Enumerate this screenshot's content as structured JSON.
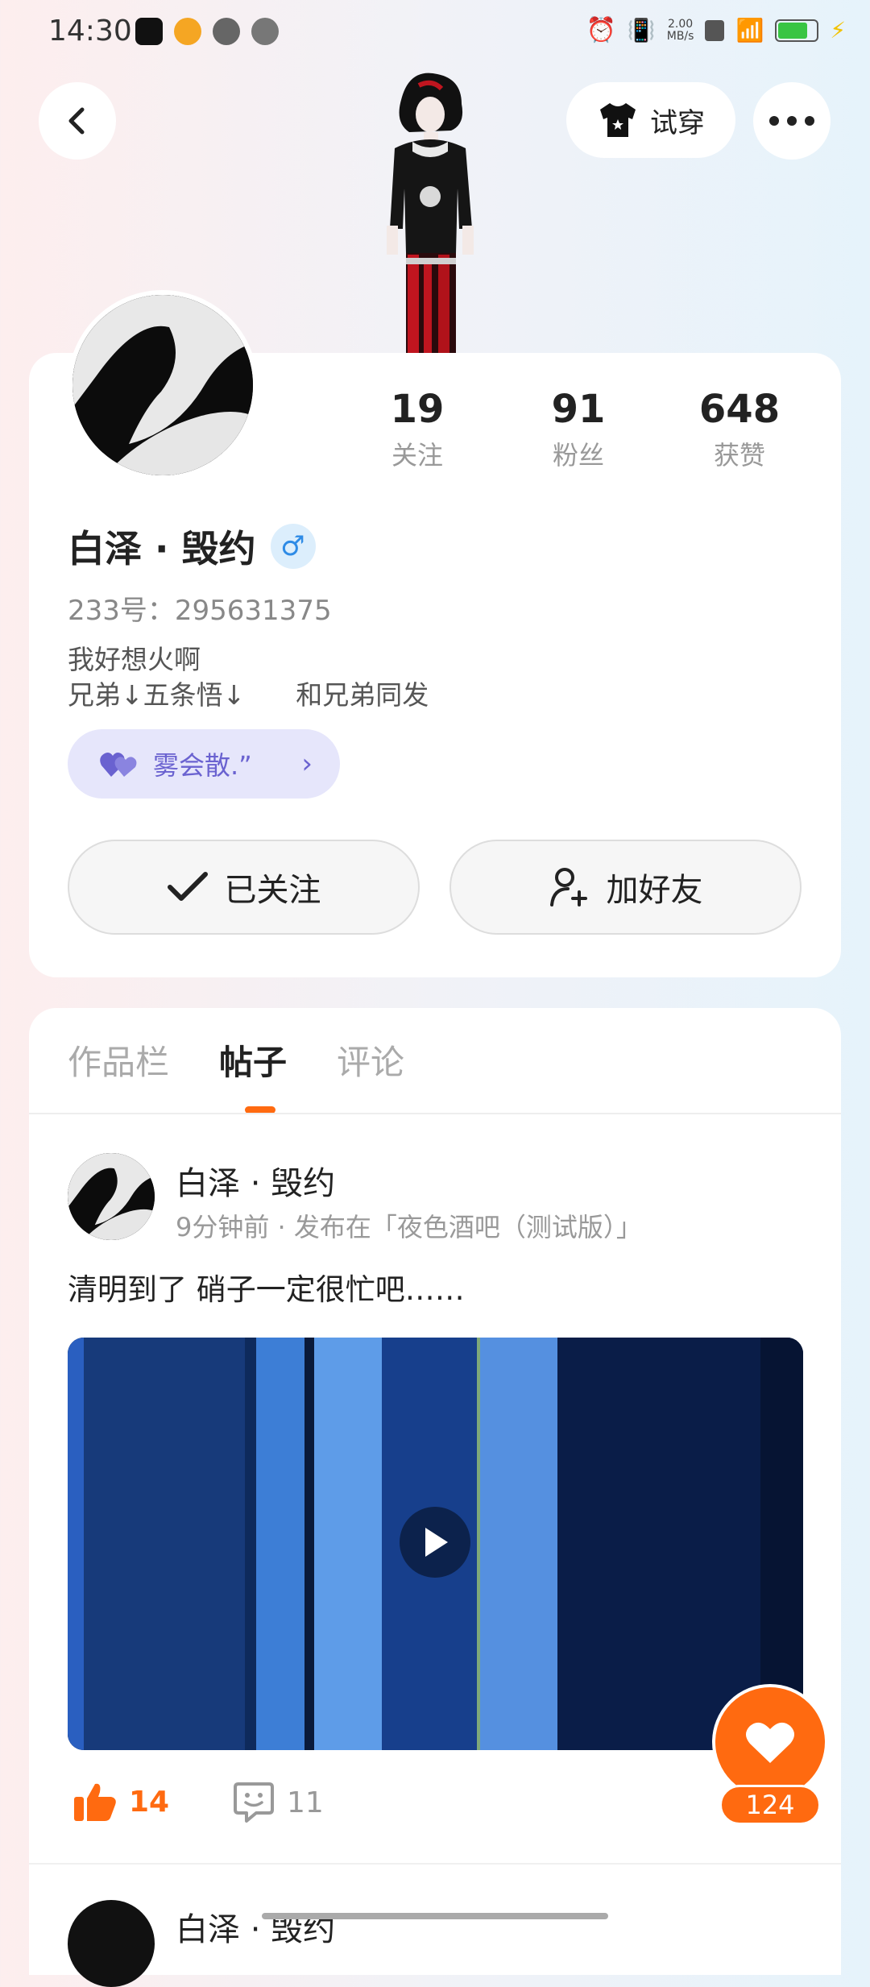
{
  "status_bar": {
    "time": "14:30",
    "net_speed_value": "2.00",
    "net_speed_unit": "MB/s",
    "battery_level": 0.8
  },
  "header": {
    "tryon_label": "试穿"
  },
  "profile": {
    "stats": [
      {
        "value": "19",
        "label": "关注"
      },
      {
        "value": "91",
        "label": "粉丝"
      },
      {
        "value": "648",
        "label": "获赞"
      }
    ],
    "username": "白泽 · 毁约",
    "gender_symbol": "♂",
    "uid": "233号：295631375",
    "bio": "我好想火啊\n兄弟↓五条悟↓      和兄弟同发",
    "group_label": "雾会散.”",
    "followed_label": "已关注",
    "add_friend_label": "加好友"
  },
  "tabs": [
    {
      "label": "作品栏"
    },
    {
      "label": "帖子"
    },
    {
      "label": "评论"
    }
  ],
  "post": {
    "author": "白泽 · 毁约",
    "meta": "9分钟前 · 发布在「夜色酒吧（测试版）」",
    "text": "清明到了 硝子一定很忙吧……",
    "likes": "14",
    "comments": "11"
  },
  "fab": {
    "count": "124"
  },
  "next_post": {
    "author": "白泽 · 毁约"
  },
  "colors": {
    "accent": "#ff6a10",
    "group_pill_bg": "#e6e6fb",
    "group_pill_text": "#6a62d0",
    "gender_blue": "#2e8be6"
  }
}
